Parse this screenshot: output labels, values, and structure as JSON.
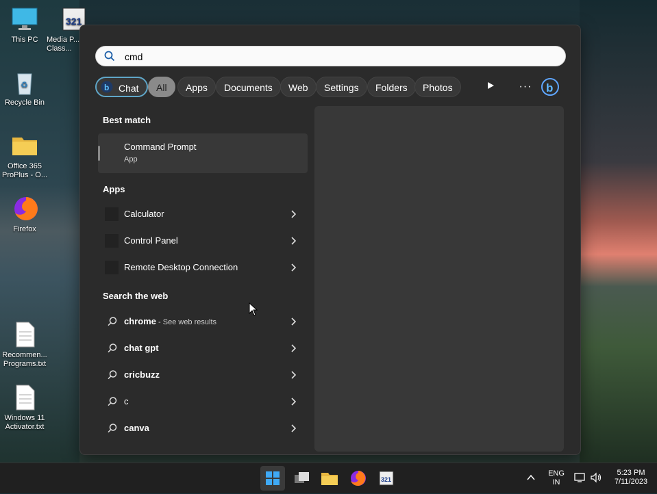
{
  "desktop": {
    "icons": [
      {
        "label": "This PC"
      },
      {
        "label": "Media P... Class..."
      },
      {
        "label": "Recycle Bin"
      },
      {
        "label": "Office 365 ProPlus - O..."
      },
      {
        "label": "Firefox"
      },
      {
        "label": "Recommen... Programs.txt"
      },
      {
        "label": "Windows 11 Activator.txt"
      }
    ]
  },
  "search": {
    "query": "cmd"
  },
  "filters": {
    "chat": "Chat",
    "all": "All",
    "apps": "Apps",
    "documents": "Documents",
    "web": "Web",
    "settings": "Settings",
    "folders": "Folders",
    "photos": "Photos"
  },
  "sections": {
    "best_match": "Best match",
    "apps": "Apps",
    "search_web": "Search the web"
  },
  "best_match": {
    "name": "Command Prompt",
    "type": "App"
  },
  "apps": [
    {
      "label": "Calculator"
    },
    {
      "label": "Control Panel"
    },
    {
      "label": "Remote Desktop Connection"
    }
  ],
  "web": [
    {
      "term": "chrome",
      "hint": " - See web results"
    },
    {
      "term": "chat gpt",
      "hint": ""
    },
    {
      "term": "cricbuzz",
      "hint": ""
    },
    {
      "term": "c",
      "hint": ""
    },
    {
      "term": "canva",
      "hint": ""
    }
  ],
  "tray": {
    "lang_top": "ENG",
    "lang_bottom": "IN",
    "time": "5:23 PM",
    "date": "7/11/2023"
  },
  "colors": {
    "panel": "#2b2b2b",
    "accent": "#5fa6c8"
  }
}
